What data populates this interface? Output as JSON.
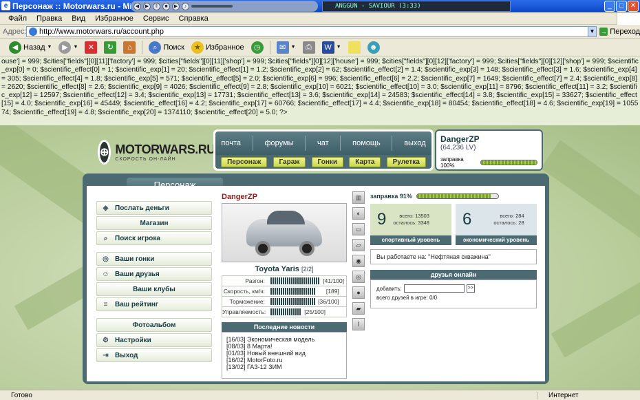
{
  "window": {
    "title": "Персонаж :: Motorwars.ru - Microsoft",
    "media_track": "ANGGUN - SAVIOUR (3:33)"
  },
  "menubar": [
    "Файл",
    "Правка",
    "Вид",
    "Избранное",
    "Сервис",
    "Справка"
  ],
  "address": {
    "label": "Адрес:",
    "url": "http://www.motorwars.ru/account.php",
    "go": "Переход"
  },
  "toolbar": {
    "back": "Назад",
    "search": "Поиск",
    "favorites": "Избранное"
  },
  "code_text": "ouse'] = 999; $cities[\"fields\"][0][11]['factory'] = 999; $cities[\"fields\"][0][11]['shop'] = 999; $cities[\"fields\"][0][12]['house'] = 999; $cities[\"fields\"][0][12]['factory'] = 999; $cities[\"fields\"][0][12]['shop'] = 999; $scientific_exp[0] = 0; $scientific_effect[0] = 1; $scientific_exp[1] = 20; $scientific_effect[1] = 1.2; $scientific_exp[2] = 62; $scientific_effect[2] = 1.4; $scientific_exp[3] = 148; $scientific_effect[3] = 1.6; $scientific_exp[4] = 305; $scientific_effect[4] = 1.8; $scientific_exp[5] = 571; $scientific_effect[5] = 2.0; $scientific_exp[6] = 996; $scientific_effect[6] = 2.2; $scientific_exp[7] = 1649; $scientific_effect[7] = 2.4; $scientific_exp[8] = 2620; $scientific_effect[8] = 2.6; $scientific_exp[9] = 4026; $scientific_effect[9] = 2.8; $scientific_exp[10] = 6021; $scientific_effect[10] = 3.0; $scientific_exp[11] = 8796; $scientific_effect[11] = 3.2; $scientific_exp[12] = 12597; $scientific_effect[12] = 3.4; $scientific_exp[13] = 17731; $scientific_effect[13] = 3.6; $scientific_exp[14] = 24583; $scientific_effect[14] = 3.8; $scientific_exp[15] = 33627; $scientific_effect[15] = 4.0; $scientific_exp[16] = 45449; $scientific_effect[16] = 4.2; $scientific_exp[17] = 60766; $scientific_effect[17] = 4.4; $scientific_exp[18] = 80454; $scientific_effect[18] = 4.6; $scientific_exp[19] = 105574; $scientific_effect[19] = 4.8; $scientific_exp[20] = 1374110; $scientific_effect[20] = 5.0; ?>",
  "logo": {
    "name": "MOTORWARS.RU",
    "tagline": "СКОРОСТЬ ОН-ЛАЙН"
  },
  "nav_top": [
    "почта",
    "форумы",
    "чат",
    "помощь",
    "выход"
  ],
  "nav_bottom": [
    "Персонаж",
    "Гараж",
    "Гонки",
    "Карта",
    "Рулетка"
  ],
  "user": {
    "name": "DangerZP",
    "lv": "(64,236 LV)",
    "fuel_label": "заправка 100%",
    "fuel_value": 1.0
  },
  "panel_title": "Персонаж",
  "menu": [
    {
      "label": "Послать деньги",
      "icon": "money-icon"
    },
    {
      "label": "Магазин",
      "icon": ""
    },
    {
      "label": "Поиск игрока",
      "icon": "magnifier-icon"
    },
    {
      "label": "Ваши гонки",
      "icon": "wheel-icon"
    },
    {
      "label": "Ваши друзья",
      "icon": "people-icon"
    },
    {
      "label": "Ваши клубы",
      "icon": ""
    },
    {
      "label": "Ваш рейтинг",
      "icon": "rating-icon"
    },
    {
      "label": "Фотоальбом",
      "icon": ""
    },
    {
      "label": "Настройки",
      "icon": "sliders-icon"
    },
    {
      "label": "Выход",
      "icon": "exit-icon"
    }
  ],
  "player": {
    "name": "DangerZP"
  },
  "car": {
    "name": "Toyota Yaris",
    "slot": "[2/2]"
  },
  "stats": [
    {
      "label": "Разгон:",
      "value": "[41/100]",
      "fraction": 0.41
    },
    {
      "label": "Скорость, км/ч:",
      "value": "[189]",
      "fraction": 0.36
    },
    {
      "label": "Торможение:",
      "value": "[36/100]",
      "fraction": 0.36
    },
    {
      "label": "Управляемость:",
      "value": "[25/100]",
      "fraction": 0.25
    }
  ],
  "news": {
    "title": "Последние новости",
    "items": [
      "[16/03] Экономическая модель",
      "[08/03] 8 Марта!",
      "[01/03] Новый внешний вид",
      "[16/02] MotorFoto.ru",
      "[13/02] ГАЗ-12 ЗИМ"
    ]
  },
  "fuel": {
    "label": "заправка 91%",
    "value": 0.91
  },
  "sport": {
    "level": "9",
    "total_label": "всего:",
    "total": "13503",
    "left_label": "осталось:",
    "left": "3348",
    "caption": "спортивный уровень"
  },
  "econ": {
    "level": "6",
    "total_label": "всего:",
    "total": "284",
    "left_label": "осталось:",
    "left": "28",
    "caption": "экономический уровень"
  },
  "work": "Вы работаете на: \"Нефтяная скважина\"",
  "friends": {
    "title": "друзья онлайн",
    "add_label": "добавить:",
    "add_button": ">>",
    "count_text": "всего друзей в игре: 0/0"
  },
  "status": {
    "left": "Готово",
    "right": "Интернет"
  }
}
